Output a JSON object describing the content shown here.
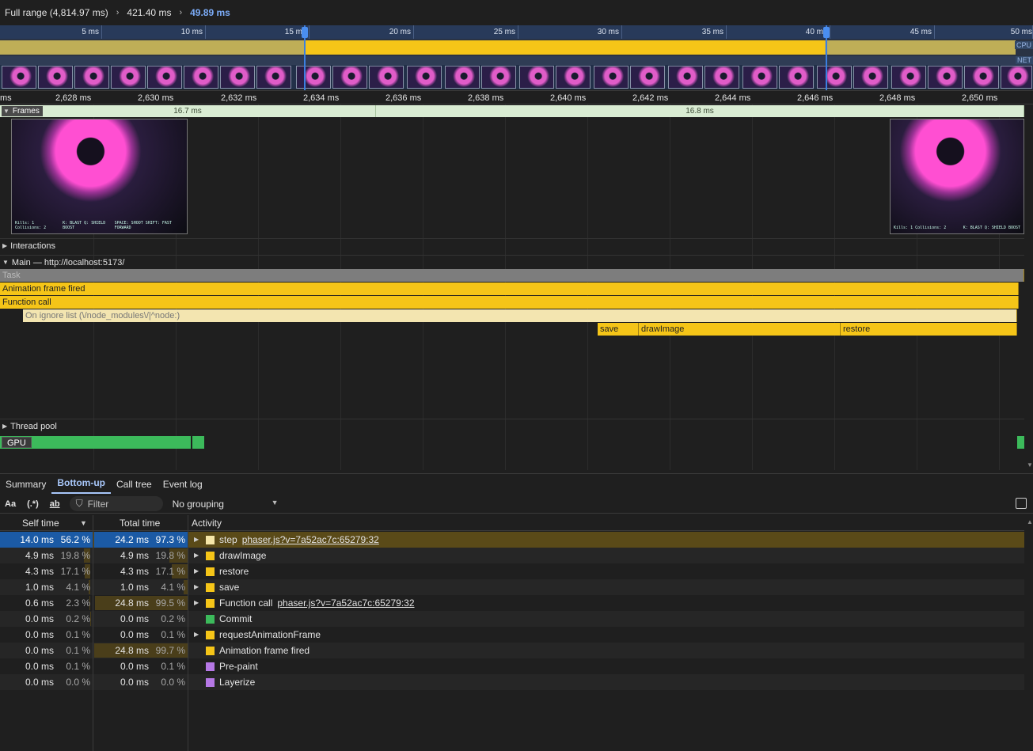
{
  "breadcrumb": {
    "items": [
      "Full range (4,814.97 ms)",
      "421.40 ms",
      "49.89 ms"
    ],
    "separator": "›"
  },
  "overview": {
    "ticks": [
      "5 ms",
      "10 ms",
      "15 ms",
      "20 ms",
      "25 ms",
      "30 ms",
      "35 ms",
      "40 ms",
      "45 ms",
      "50 ms"
    ],
    "cpu_label": "CPU",
    "net_label": "NET"
  },
  "main_ruler": {
    "labels": [
      "ms",
      "2,628 ms",
      "2,630 ms",
      "2,632 ms",
      "2,634 ms",
      "2,636 ms",
      "2,638 ms",
      "2,640 ms",
      "2,642 ms",
      "2,644 ms",
      "2,646 ms",
      "2,648 ms",
      "2,650 ms"
    ]
  },
  "frames": {
    "label": "Frames",
    "segments": [
      "16.7 ms",
      "16.8 ms"
    ],
    "hud_left": "Kills: 1  Collisions: 2",
    "hud_mid": "K: BLAST  Q: SHIELD BOOST",
    "hud_right": "SPACE: SHOOT  SHIFT: FAST FORWARD"
  },
  "tracks": {
    "interactions": "Interactions",
    "main": "Main — http://localhost:5173/",
    "thread_pool": "Thread pool",
    "gpu": "GPU"
  },
  "flame": {
    "task": "Task",
    "animation_frame": "Animation frame fired",
    "function_call": "Function call",
    "ignore_list": "On ignore list (\\/node_modules\\/|^node:)",
    "save": "save",
    "draw_image": "drawImage",
    "restore": "restore"
  },
  "bottom_tabs": [
    "Summary",
    "Bottom-up",
    "Call tree",
    "Event log"
  ],
  "toolbar": {
    "match_case": "Aa",
    "regex": "(.*)",
    "whole_word": "ab",
    "filter_placeholder": "Filter",
    "grouping": "No grouping"
  },
  "table": {
    "headers": {
      "self": "Self time",
      "total": "Total time",
      "activity": "Activity"
    },
    "rows": [
      {
        "self_ms": "14.0 ms",
        "self_pct": "56.2 %",
        "self_frac": 0.562,
        "total_ms": "24.2 ms",
        "total_pct": "97.3 %",
        "total_frac": 0.973,
        "activity": "step",
        "url": "phaser.js?v=7a52ac7c:65279:32",
        "color": "#f5e6a8",
        "expandable": true
      },
      {
        "self_ms": "4.9 ms",
        "self_pct": "19.8 %",
        "self_frac": 0.198,
        "total_ms": "4.9 ms",
        "total_pct": "19.8 %",
        "total_frac": 0.198,
        "activity": "drawImage",
        "url": "",
        "color": "#f5c518",
        "expandable": true
      },
      {
        "self_ms": "4.3 ms",
        "self_pct": "17.1 %",
        "self_frac": 0.171,
        "total_ms": "4.3 ms",
        "total_pct": "17.1 %",
        "total_frac": 0.171,
        "activity": "restore",
        "url": "",
        "color": "#f5c518",
        "expandable": true
      },
      {
        "self_ms": "1.0 ms",
        "self_pct": "4.1 %",
        "self_frac": 0.041,
        "total_ms": "1.0 ms",
        "total_pct": "4.1 %",
        "total_frac": 0.041,
        "activity": "save",
        "url": "",
        "color": "#f5c518",
        "expandable": true
      },
      {
        "self_ms": "0.6 ms",
        "self_pct": "2.3 %",
        "self_frac": 0.023,
        "total_ms": "24.8 ms",
        "total_pct": "99.5 %",
        "total_frac": 0.995,
        "activity": "Function call",
        "url": "phaser.js?v=7a52ac7c:65279:32",
        "color": "#f5c518",
        "expandable": true
      },
      {
        "self_ms": "0.0 ms",
        "self_pct": "0.2 %",
        "self_frac": 0.002,
        "total_ms": "0.0 ms",
        "total_pct": "0.2 %",
        "total_frac": 0.002,
        "activity": "Commit",
        "url": "",
        "color": "#3cba5b",
        "expandable": false
      },
      {
        "self_ms": "0.0 ms",
        "self_pct": "0.1 %",
        "self_frac": 0.001,
        "total_ms": "0.0 ms",
        "total_pct": "0.1 %",
        "total_frac": 0.001,
        "activity": "requestAnimationFrame",
        "url": "",
        "color": "#f5c518",
        "expandable": true
      },
      {
        "self_ms": "0.0 ms",
        "self_pct": "0.1 %",
        "self_frac": 0.001,
        "total_ms": "24.8 ms",
        "total_pct": "99.7 %",
        "total_frac": 0.997,
        "activity": "Animation frame fired",
        "url": "",
        "color": "#f5c518",
        "expandable": false
      },
      {
        "self_ms": "0.0 ms",
        "self_pct": "0.1 %",
        "self_frac": 0.001,
        "total_ms": "0.0 ms",
        "total_pct": "0.1 %",
        "total_frac": 0.001,
        "activity": "Pre-paint",
        "url": "",
        "color": "#b678e6",
        "expandable": false
      },
      {
        "self_ms": "0.0 ms",
        "self_pct": "0.0 %",
        "self_frac": 0.0,
        "total_ms": "0.0 ms",
        "total_pct": "0.0 %",
        "total_frac": 0.0,
        "activity": "Layerize",
        "url": "",
        "color": "#b678e6",
        "expandable": false
      }
    ]
  },
  "colors": {
    "accent": "#a8c7fa",
    "scripting": "#f5c518",
    "painting": "#3cba5b",
    "rendering": "#b678e6",
    "selection": "#1b5aa5"
  }
}
